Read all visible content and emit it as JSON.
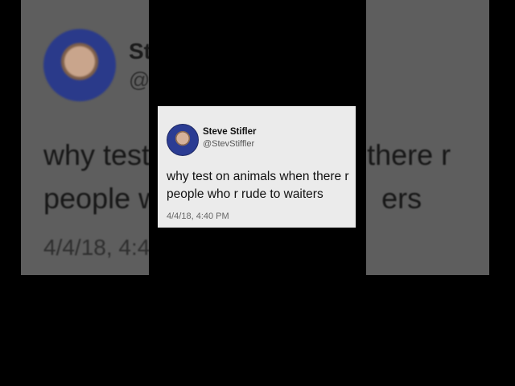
{
  "tweet": {
    "author_name": "Steve Stifler",
    "author_handle": "@StevStiffler",
    "text": "why test on animals when there r people who r rude to waiters",
    "timestamp": "4/4/18, 4:40 PM"
  },
  "background": {
    "name_fragment": "St",
    "handle_fragment": "@",
    "line1_left": "why test",
    "line1_right": "n there r",
    "line2_left": "people w",
    "line2_right": "ers",
    "time_fragment": "4/4/18, 4:4"
  }
}
